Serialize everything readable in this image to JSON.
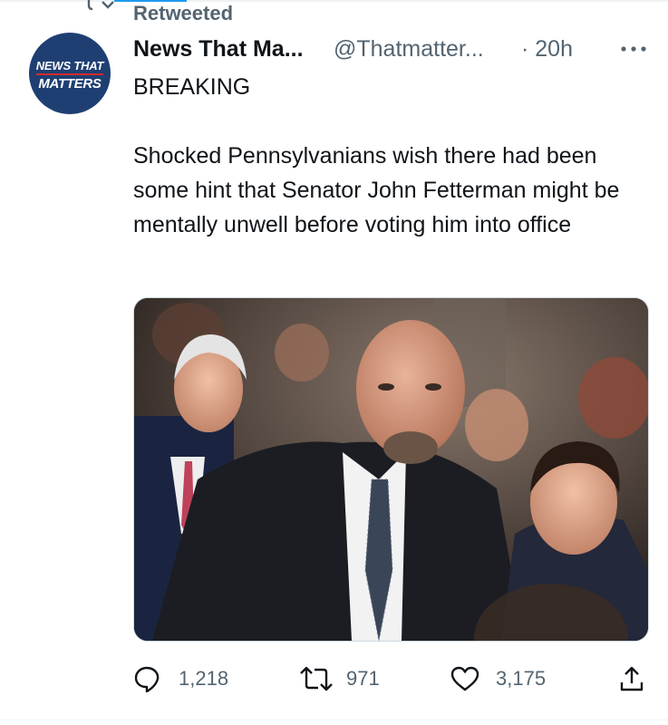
{
  "retweet_banner": {
    "label": "Retweeted"
  },
  "account": {
    "avatar_line1": "NEWS THAT",
    "avatar_line2": "MATTERS",
    "display_name": "News That Ma...",
    "handle": "@Thatmatter...",
    "timestamp": "· 20h"
  },
  "tweet": {
    "headline": "BREAKING",
    "text": "Shocked Pennsylvanians wish there had been some hint that Senator John Fetterman might be mentally unwell before voting him into office"
  },
  "actions": {
    "replies": "1,218",
    "retweets": "971",
    "likes": "3,175"
  },
  "colors": {
    "accent": "#1d9bf0",
    "text_primary": "#0f1419",
    "text_secondary": "#536471",
    "avatar_bg": "#1f3f73",
    "avatar_stripe": "#d22b2b"
  },
  "icons": {
    "retweeted": "retweet-icon",
    "more": "more-dots-icon",
    "reply": "reply-icon",
    "retweet": "retweet-icon",
    "like": "heart-icon",
    "share": "share-icon"
  }
}
